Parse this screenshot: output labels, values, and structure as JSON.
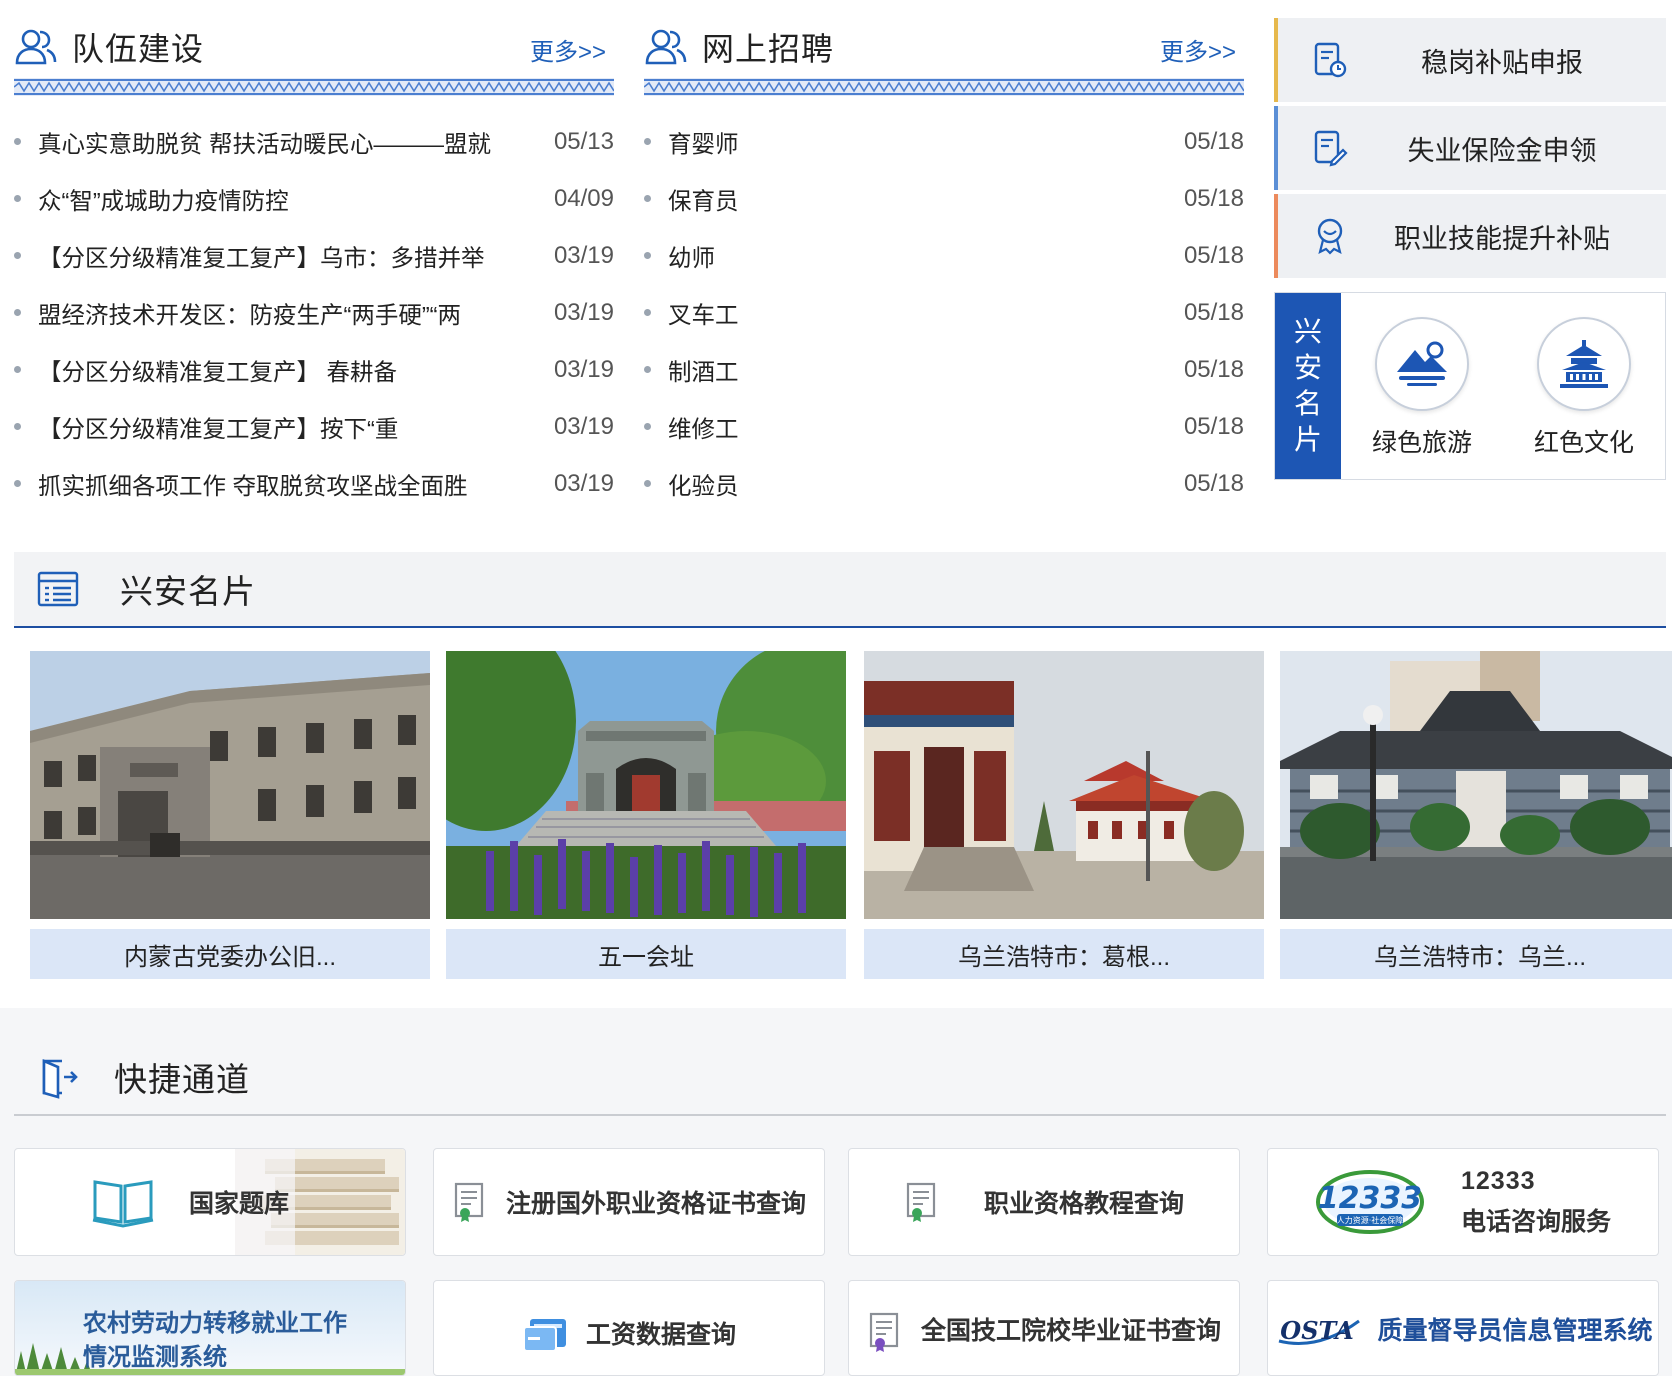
{
  "team": {
    "title": "队伍建设",
    "more": "更多>>",
    "items": [
      {
        "text": "真心实意助脱贫 帮扶活动暖民心———盟就",
        "date": "05/13"
      },
      {
        "text": "众“智”成城助力疫情防控",
        "date": "04/09"
      },
      {
        "text": "【分区分级精准复工复产】乌市：多措并举",
        "date": "03/19"
      },
      {
        "text": "盟经济技术开发区：防疫生产“两手硬”“两",
        "date": "03/19"
      },
      {
        "text": "【分区分级精准复工复产】 春耕备",
        "date": "03/19"
      },
      {
        "text": "【分区分级精准复工复产】按下“重",
        "date": "03/19"
      },
      {
        "text": "抓实抓细各项工作 夺取脱贫攻坚战全面胜",
        "date": "03/19"
      }
    ]
  },
  "recruit": {
    "title": "网上招聘",
    "more": "更多>>",
    "items": [
      {
        "text": "育婴师",
        "date": "05/18"
      },
      {
        "text": "保育员",
        "date": "05/18"
      },
      {
        "text": "幼师",
        "date": "05/18"
      },
      {
        "text": "叉车工",
        "date": "05/18"
      },
      {
        "text": "制酒工",
        "date": "05/18"
      },
      {
        "text": "维修工",
        "date": "05/18"
      },
      {
        "text": "化验员",
        "date": "05/18"
      }
    ]
  },
  "services": [
    {
      "label": "稳岗补贴申报",
      "accent": "#e6b84c"
    },
    {
      "label": "失业保险金申领",
      "accent": "#5b8fd6"
    },
    {
      "label": "职业技能提升补贴",
      "accent": "#ec8a5c"
    }
  ],
  "card_box": {
    "vertical_label": [
      "兴",
      "安",
      "名",
      "片"
    ],
    "items": [
      {
        "label": "绿色旅游",
        "icon": "mountain-icon"
      },
      {
        "label": "红色文化",
        "icon": "pavilion-icon"
      }
    ]
  },
  "mingpian": {
    "title": "兴安名片",
    "photos": [
      {
        "caption": "内蒙古党委办公旧..."
      },
      {
        "caption": "五一会址"
      },
      {
        "caption": "乌兰浩特市：葛根..."
      },
      {
        "caption": "乌兰浩特市：乌兰..."
      }
    ]
  },
  "quick": {
    "title": "快捷通道",
    "row1": [
      {
        "label": "国家题库",
        "icon": "book-icon"
      },
      {
        "label": "注册国外职业资格证书查询",
        "icon": "certificate-icon"
      },
      {
        "label": "职业资格教程查询",
        "icon": "certificate-icon"
      },
      {
        "number": "12333",
        "label": "电话咨询服务",
        "logo_text": "12333",
        "logo_sub": "人力资源·社会保障"
      }
    ],
    "row2": [
      {
        "label_line1": "农村劳动力转移就业工作",
        "label_line2": "情况监测系统"
      },
      {
        "label": "工资数据查询",
        "icon": "card-icon"
      },
      {
        "label": "全国技工院校毕业证书查询",
        "icon": "certificate-icon"
      },
      {
        "logo": "OSTA",
        "label": "质量督导员信息管理系统"
      }
    ]
  },
  "colors": {
    "brand_blue": "#1d56b4",
    "link_blue": "#1f5fb8",
    "caption_bg": "#dbe6f7"
  }
}
